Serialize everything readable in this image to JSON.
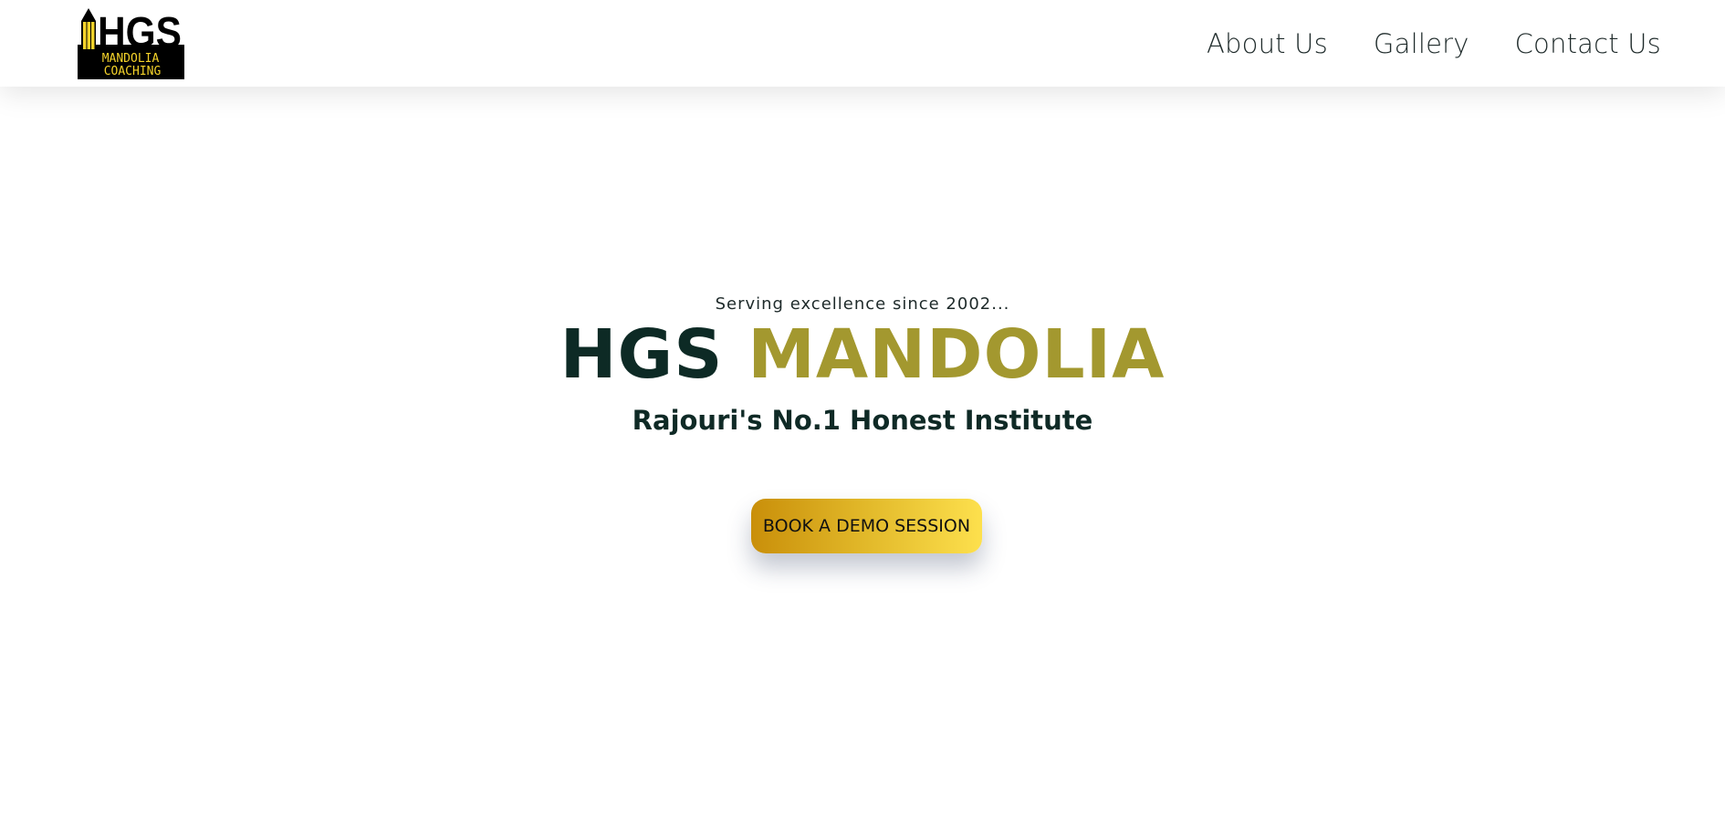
{
  "brand": {
    "logo_text": "HGS",
    "logo_sub1": "MANDOLIA",
    "logo_sub2": "COACHING",
    "colors": {
      "logo_yellow": "#f5d32a",
      "gold_accent": "#a3982f",
      "dark_green": "#0d2a25"
    }
  },
  "nav": {
    "items": [
      {
        "label": "About Us"
      },
      {
        "label": "Gallery"
      },
      {
        "label": "Contact Us"
      }
    ]
  },
  "hero": {
    "tagline": "Serving excellence since 2002...",
    "title_part1": "HGS",
    "title_part2": "MANDOLIA",
    "subtitle": "Rajouri's No.1 Honest Institute",
    "cta_label": "BOOK A DEMO SESSION",
    "cta_gradient": [
      "#c98f0a",
      "#fde04d"
    ]
  },
  "icons": [
    "pencil-icon"
  ]
}
